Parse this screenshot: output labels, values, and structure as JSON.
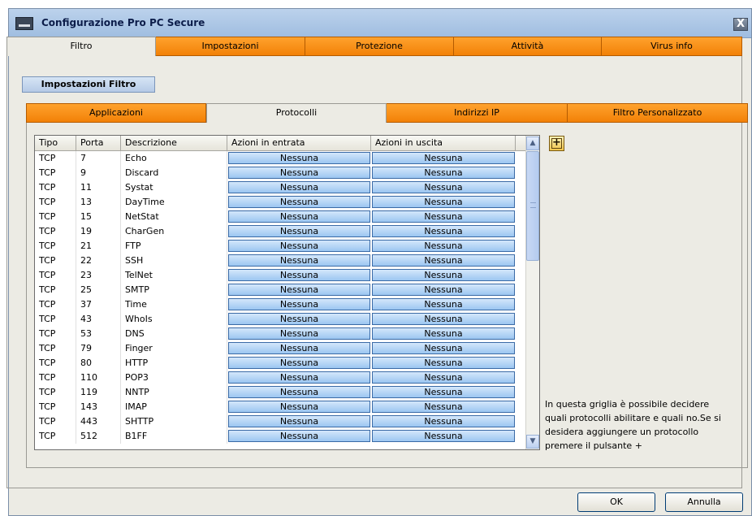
{
  "window": {
    "title": "Configurazione Pro PC Secure",
    "close_glyph": "X"
  },
  "main_tabs": [
    {
      "label": "Filtro",
      "active": true
    },
    {
      "label": "Impostazioni",
      "active": false
    },
    {
      "label": "Protezione",
      "active": false
    },
    {
      "label": "Attività",
      "active": false
    },
    {
      "label": "Virus info",
      "active": false
    }
  ],
  "section_label": "Impostazioni Filtro",
  "sub_tabs": [
    {
      "label": "Applicazioni",
      "active": false
    },
    {
      "label": "Protocolli",
      "active": true
    },
    {
      "label": "Indirizzi IP",
      "active": false
    },
    {
      "label": "Filtro Personalizzato",
      "active": false
    }
  ],
  "grid": {
    "headers": [
      "Tipo",
      "Porta",
      "Descrizione",
      "Azioni in entrata",
      "Azioni in uscita"
    ],
    "rows": [
      [
        "TCP",
        "7",
        "Echo",
        "Nessuna",
        "Nessuna"
      ],
      [
        "TCP",
        "9",
        "Discard",
        "Nessuna",
        "Nessuna"
      ],
      [
        "TCP",
        "11",
        "Systat",
        "Nessuna",
        "Nessuna"
      ],
      [
        "TCP",
        "13",
        "DayTime",
        "Nessuna",
        "Nessuna"
      ],
      [
        "TCP",
        "15",
        "NetStat",
        "Nessuna",
        "Nessuna"
      ],
      [
        "TCP",
        "19",
        "CharGen",
        "Nessuna",
        "Nessuna"
      ],
      [
        "TCP",
        "21",
        "FTP",
        "Nessuna",
        "Nessuna"
      ],
      [
        "TCP",
        "22",
        "SSH",
        "Nessuna",
        "Nessuna"
      ],
      [
        "TCP",
        "23",
        "TelNet",
        "Nessuna",
        "Nessuna"
      ],
      [
        "TCP",
        "25",
        "SMTP",
        "Nessuna",
        "Nessuna"
      ],
      [
        "TCP",
        "37",
        "Time",
        "Nessuna",
        "Nessuna"
      ],
      [
        "TCP",
        "43",
        "WhoIs",
        "Nessuna",
        "Nessuna"
      ],
      [
        "TCP",
        "53",
        "DNS",
        "Nessuna",
        "Nessuna"
      ],
      [
        "TCP",
        "79",
        "Finger",
        "Nessuna",
        "Nessuna"
      ],
      [
        "TCP",
        "80",
        "HTTP",
        "Nessuna",
        "Nessuna"
      ],
      [
        "TCP",
        "110",
        "POP3",
        "Nessuna",
        "Nessuna"
      ],
      [
        "TCP",
        "119",
        "NNTP",
        "Nessuna",
        "Nessuna"
      ],
      [
        "TCP",
        "143",
        "IMAP",
        "Nessuna",
        "Nessuna"
      ],
      [
        "TCP",
        "443",
        "SHTTP",
        "Nessuna",
        "Nessuna"
      ],
      [
        "TCP",
        "512",
        "B1FF",
        "Nessuna",
        "Nessuna"
      ]
    ]
  },
  "add_button_glyph": "+",
  "info_text": "In questa griglia è possibile decidere quali protocolli abilitare e quali no.Se si desidera aggiungere un protocollo premere il pulsante +",
  "buttons": {
    "ok": "OK",
    "cancel": "Annulla"
  },
  "colors": {
    "tab_orange": "#f28107",
    "title_blue": "#9fbde0",
    "action_blue": "#9cc6f1"
  },
  "icons": {
    "window": "window-icon",
    "close": "close-icon",
    "add": "add-icon",
    "scroll_up": "scroll-up-icon",
    "scroll_down": "scroll-down-icon"
  }
}
